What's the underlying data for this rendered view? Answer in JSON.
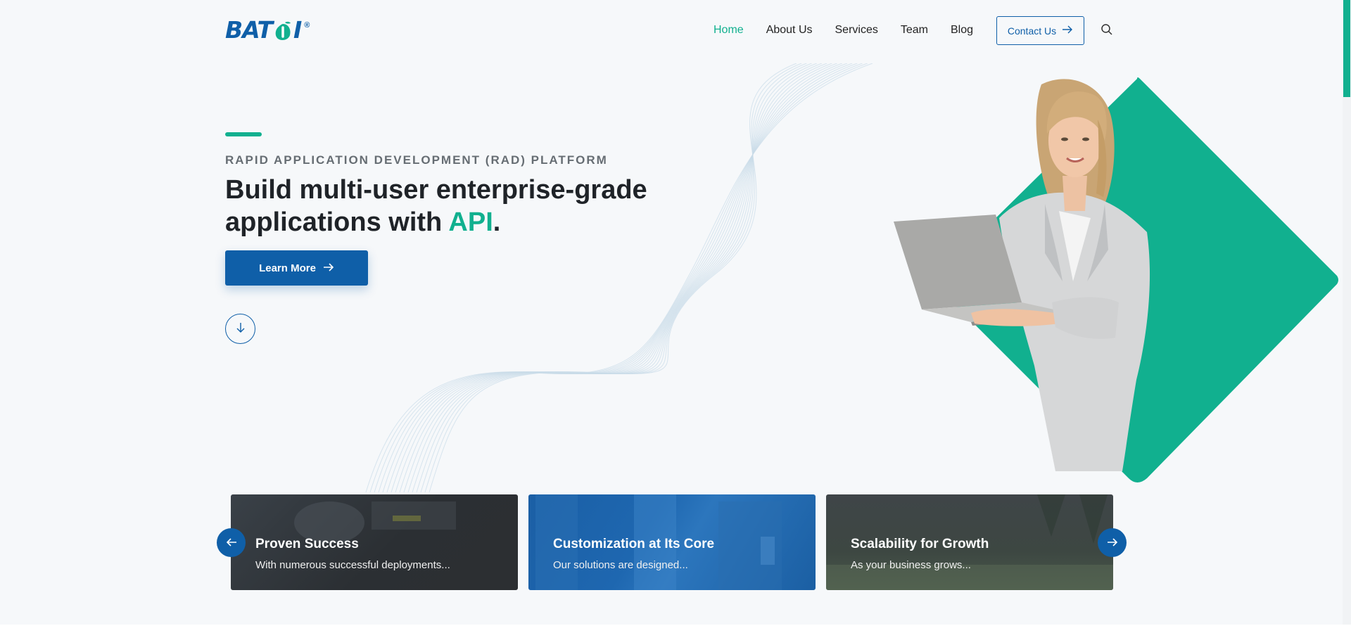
{
  "brand": {
    "logo_text_left": "BAT",
    "logo_text_right": "I",
    "registered": "®",
    "colors": {
      "primary": "#0f5fa8",
      "accent": "#11b08f",
      "text": "#1f2328",
      "muted": "#666d73"
    }
  },
  "nav": {
    "items": [
      {
        "label": "Home",
        "active": true
      },
      {
        "label": "About Us",
        "active": false
      },
      {
        "label": "Services",
        "active": false
      },
      {
        "label": "Team",
        "active": false
      },
      {
        "label": "Blog",
        "active": false
      }
    ],
    "contact_label": "Contact Us",
    "contact_icon": "arrow-right-icon",
    "search_icon": "search-icon"
  },
  "hero": {
    "eyebrow": "RAPID APPLICATION DEVELOPMENT (RAD) PLATFORM",
    "headline_part1": "Build multi-user enterprise-grade applications with ",
    "headline_highlight": "API",
    "headline_end": ".",
    "cta_label": "Learn More",
    "cta_icon": "arrow-right-icon",
    "scroll_icon": "arrow-down-icon"
  },
  "slider": {
    "prev_icon": "arrow-left-icon",
    "next_icon": "arrow-right-icon",
    "cards": [
      {
        "title": "Proven Success",
        "subtitle": "With numerous successful deployments..."
      },
      {
        "title": "Customization at Its Core",
        "subtitle": "Our solutions are designed..."
      },
      {
        "title": "Scalability for Growth",
        "subtitle": "As your business grows..."
      }
    ]
  }
}
